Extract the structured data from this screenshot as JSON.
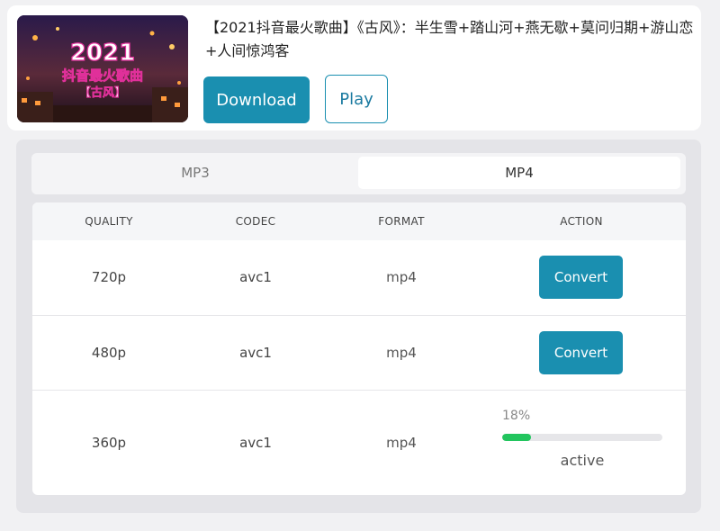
{
  "video": {
    "title": "【2021抖音最火歌曲】《古风》：半生雪+踏山河+燕无歇+莫问归期+游山恋+人间惊鸿客",
    "thumbnail": {
      "year": "2021",
      "line1": "抖音最火歌曲",
      "line2": "【古风】"
    },
    "download_label": "Download",
    "play_label": "Play"
  },
  "tabs": [
    {
      "label": "MP3",
      "active": false
    },
    {
      "label": "MP4",
      "active": true
    }
  ],
  "table": {
    "headers": [
      "QUALITY",
      "CODEC",
      "FORMAT",
      "ACTION"
    ],
    "rows": [
      {
        "quality": "720p",
        "codec": "avc1",
        "format": "mp4",
        "action": "Convert"
      },
      {
        "quality": "480p",
        "codec": "avc1",
        "format": "mp4",
        "action": "Convert"
      },
      {
        "quality": "360p",
        "codec": "avc1",
        "format": "mp4",
        "progress_label": "18%",
        "progress": 0.18,
        "status": "active"
      }
    ]
  },
  "colors": {
    "accent": "#1a8fb0",
    "progress": "#22c55e"
  }
}
